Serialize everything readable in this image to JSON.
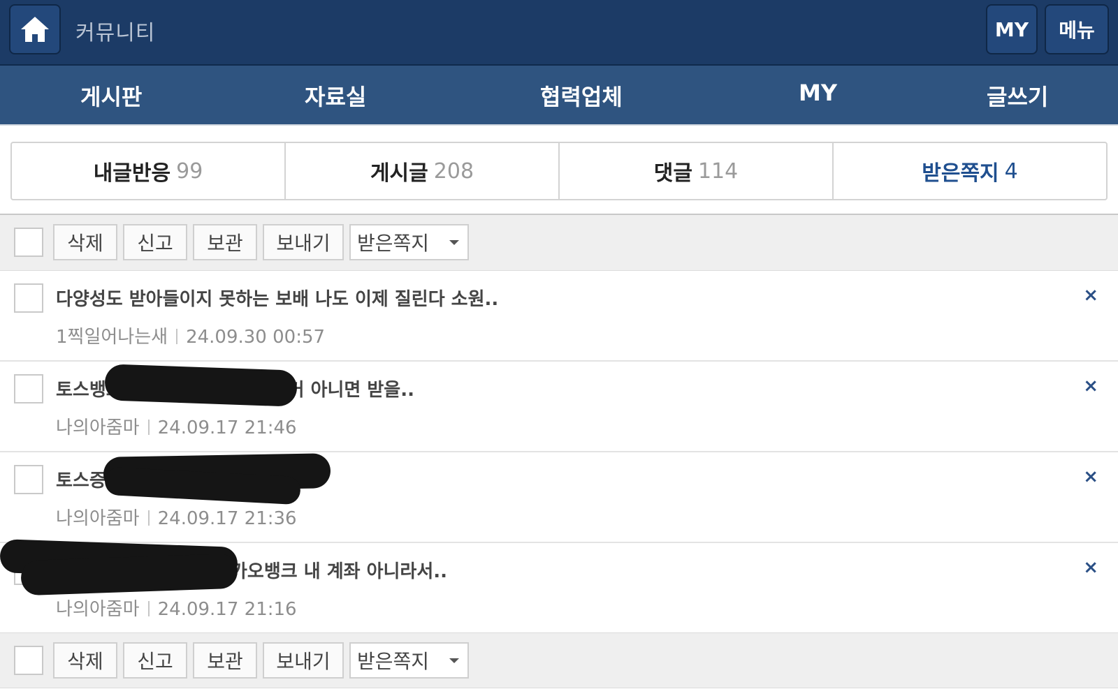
{
  "topbar": {
    "title": "커뮤니티",
    "my_label": "MY",
    "menu_label": "메뉴",
    "home_icon": "home-icon"
  },
  "nav": [
    {
      "label": "게시판"
    },
    {
      "label": "자료실"
    },
    {
      "label": "협력업체"
    },
    {
      "label": "MY"
    },
    {
      "label": "글쓰기"
    }
  ],
  "tabs": [
    {
      "label": "내글반응",
      "count": "99"
    },
    {
      "label": "게시글",
      "count": "208"
    },
    {
      "label": "댓글",
      "count": "114"
    },
    {
      "label": "받은쪽지",
      "count": "4",
      "active": true
    }
  ],
  "toolbar": {
    "delete_label": "삭제",
    "report_label": "신고",
    "archive_label": "보관",
    "send_label": "보내기",
    "folder_select": "받은쪽지"
  },
  "messages": [
    {
      "title": "다양성도 받아들이지 못하는 보배 나도 이제 질린다 소원..",
      "sender": "1찍일어나는새",
      "date": "24.09.30 00:57"
    },
    {
      "title": "토스뱅크",
      "title_tail": "이거 아니면 받을..",
      "sender": "나의아줌마",
      "date": "24.09.17 21:46"
    },
    {
      "title": "토스증",
      "sender": "나의아줌마",
      "date": "24.09.17 21:36"
    },
    {
      "title_tail": "카오뱅크 내 계좌 아니라서..",
      "sender": "나의아줌마",
      "date": "24.09.17 21:16"
    }
  ],
  "close_glyph": "×",
  "colors": {
    "topbar_bg": "#1c3b66",
    "navbar_bg": "#2f5480",
    "active_tab": "#1f4f8f"
  }
}
